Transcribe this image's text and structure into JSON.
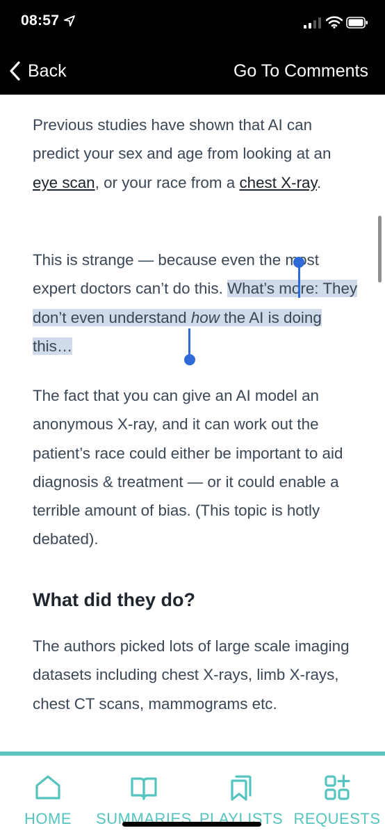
{
  "status_bar": {
    "time": "08:57"
  },
  "nav": {
    "back_label": "Back",
    "comments_label": "Go To Comments"
  },
  "article": {
    "p1": {
      "t1": "Previous studies have shown that AI can predict your sex and age from looking at an ",
      "link1": "eye scan",
      "t2": ", or your race from a ",
      "link2": "chest X-ray",
      "t3": "."
    },
    "p2": {
      "t1": "This is strange — because even the most expert doctors can’t do this. ",
      "sel1": "What’s more: They don’t even understand ",
      "sel_em": "how",
      "sel2": " the AI is doing this…"
    },
    "p3": "The fact that you can give an AI model an anonymous X-ray, and it can work out the patient’s race could either be important to aid diagnosis & treatment — or it could enable a terrible amount of bias. (This topic is hotly debated).",
    "h1": "What did they do?",
    "p4": "The authors picked lots of large scale imaging datasets including chest X-rays, limb X-rays, chest CT scans, mammograms etc."
  },
  "tabs": [
    {
      "label": "HOME",
      "icon": "home-icon"
    },
    {
      "label": "SUMMARIES",
      "icon": "book-icon"
    },
    {
      "label": "PLAYLISTS",
      "icon": "bookmarks-icon"
    },
    {
      "label": "REQUESTS",
      "icon": "grid-plus-icon"
    }
  ],
  "colors": {
    "accent": "#55c3be",
    "selection": "#cfdbeb",
    "handle": "#2f6bd8",
    "text": "#3a4756"
  }
}
